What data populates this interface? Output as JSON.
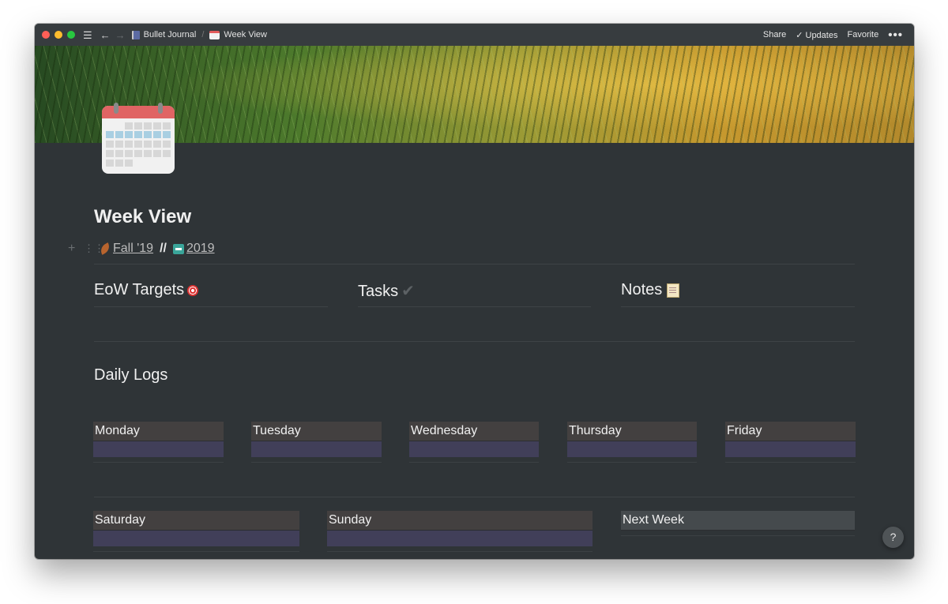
{
  "titlebar": {
    "breadcrumb": [
      "Bullet Journal",
      "Week View"
    ],
    "actions": {
      "share": "Share",
      "updates": "Updates",
      "favorite": "Favorite"
    }
  },
  "page": {
    "title": "Week View",
    "links": {
      "season": "Fall '19",
      "separator": "//",
      "year": "2019"
    }
  },
  "sections": {
    "eow_targets": "EoW Targets",
    "tasks": "Tasks",
    "notes": "Notes",
    "daily_logs": "Daily Logs"
  },
  "days_row1": [
    "Monday",
    "Tuesday",
    "Wednesday",
    "Thursday",
    "Friday"
  ],
  "days_row2": [
    "Saturday",
    "Sunday"
  ],
  "next_week": "Next Week",
  "help": "?",
  "colors": {
    "background": "#2f3437",
    "day_header": "#434040",
    "day_body": "#413f59"
  }
}
